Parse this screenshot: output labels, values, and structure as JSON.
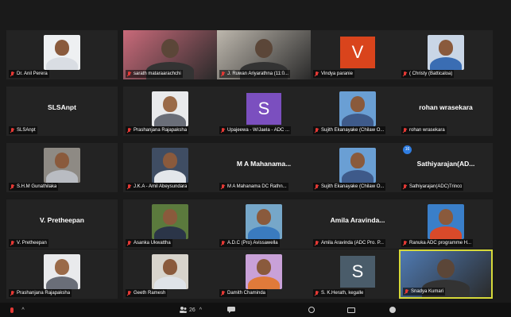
{
  "participants": [
    {
      "caption": "Dr. Anil Perera",
      "kind": "photo",
      "skin": "#8a5a3c",
      "shirt": "#d9dde3",
      "bg": "#eef0f2"
    },
    {
      "caption": "sarath mataraarachchi",
      "kind": "video",
      "bg": "#c96a7a"
    },
    {
      "caption": "J. Ruwan Ariyarathna (11:0...",
      "kind": "video",
      "bg": "#bdb7ad"
    },
    {
      "caption": "Vindya paranie",
      "kind": "letter",
      "letter": "V",
      "bg": "#d9441c"
    },
    {
      "caption": "( Christy (Batticaloa)",
      "kind": "photo",
      "skin": "#8a5a3c",
      "shirt": "#3a6db3",
      "bg": "#c9d6e6"
    },
    {
      "caption": "SLSAnpt",
      "kind": "name",
      "name": "SLSAnpt"
    },
    {
      "caption": "Prashanjana Rajapaksha",
      "kind": "photo",
      "skin": "#9a6a48",
      "shirt": "#6a6e78",
      "bg": "#e9eaec"
    },
    {
      "caption": "Upajeewa - W/Jaela - ADC ...",
      "kind": "letter",
      "letter": "S",
      "bg": "#7b4fbf"
    },
    {
      "caption": "Sujith Ekanayake (Chilaw O...",
      "kind": "photo",
      "skin": "#8a5a3c",
      "shirt": "#3e5a8a",
      "bg": "#6a9fd4"
    },
    {
      "caption": "rohan wrasekara",
      "kind": "name",
      "name": "rohan wrasekara"
    },
    {
      "caption": "S.H.M Gunathilaka",
      "kind": "photo",
      "skin": "#8a5a3c",
      "shirt": "#b9bcc2",
      "bg": "#8e8a84"
    },
    {
      "caption": "J.K.A - Amil Abeysundara",
      "kind": "photo",
      "skin": "#8a5a3c",
      "shirt": "#e3e6ea",
      "bg": "#3f4d63"
    },
    {
      "caption": "M A Mahanama  DC Rathn...",
      "kind": "name",
      "name": "M A Mahanama..."
    },
    {
      "caption": "Sujith Ekanayake (Chilaw O...",
      "kind": "photo",
      "skin": "#8a5a3c",
      "shirt": "#3e5a8a",
      "bg": "#6a9fd4"
    },
    {
      "caption": "Sathiyarajan(ADC)Trinco",
      "kind": "name",
      "name": "Sathiyarajan(AD...",
      "badge": "16"
    },
    {
      "caption": "V. Pretheepan",
      "kind": "name",
      "name": "V. Pretheepan"
    },
    {
      "caption": "Asanka Ukwattha",
      "kind": "photo",
      "skin": "#8a5a3c",
      "shirt": "#2b3548",
      "bg": "#5b7a3d"
    },
    {
      "caption": "A.D.C (Pro) Avissawella",
      "kind": "photo",
      "skin": "#8a5a3c",
      "shirt": "#3a7bbf",
      "bg": "#76a7c9"
    },
    {
      "caption": "Amila Aravinda (ADC Pro. P...",
      "kind": "name",
      "name": "Amila Aravinda..."
    },
    {
      "caption": "Ranuka ADC programme H...",
      "kind": "photo",
      "skin": "#8a5a3c",
      "shirt": "#d94a2a",
      "bg": "#3a7fc9"
    },
    {
      "caption": "Prashanjana Rajapaksha",
      "kind": "photo",
      "skin": "#9a6a48",
      "shirt": "#6a6e78",
      "bg": "#e9eaec"
    },
    {
      "caption": "Geeth Ramesh",
      "kind": "photo",
      "skin": "#8a5a3c",
      "shirt": "#dfe3e8",
      "bg": "#d8d4cc"
    },
    {
      "caption": "Damith Chaminda",
      "kind": "photo",
      "skin": "#8a5a3c",
      "shirt": "#e07a3a",
      "bg": "#c9a1d8"
    },
    {
      "caption": "S. K.Herath, kegalle",
      "kind": "letter",
      "letter": "S",
      "bg": "#4a5c6a"
    },
    {
      "caption": "Snadya Kumari",
      "kind": "video",
      "bg": "#4f7ab2",
      "active": true
    }
  ],
  "toolbar": {
    "participants_count": "26",
    "accent": "#2fbf5a",
    "icons": [
      "mic-icon",
      "participants-icon",
      "chat-icon",
      "share-screen-icon",
      "record-icon",
      "captions-icon",
      "reactions-icon"
    ]
  },
  "colors": {
    "mic_off": "#e53935",
    "active_speaker": "#d6d93a",
    "tile_bg": "#232323"
  }
}
